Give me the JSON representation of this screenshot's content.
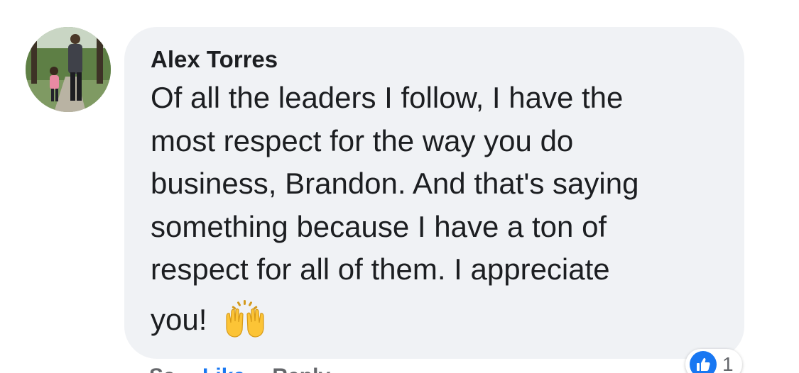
{
  "comment": {
    "author": "Alex Torres",
    "text_lines": [
      "Of all the leaders I follow, I have the",
      "most respect for the way you do",
      "business, Brandon. And that's saying",
      "something because I have a ton of",
      "respect for all of them. I appreciate"
    ],
    "last_line": "you!",
    "emoji": "raising-hands-emoji"
  },
  "actions": {
    "first": "Sa",
    "like": "Like",
    "reply": "Reply"
  },
  "reactions": {
    "icon": "thumbs-up-icon",
    "count": "1",
    "color": "#1877f2"
  },
  "colors": {
    "bubble": "#f0f2f5",
    "text": "#1c1e21",
    "link": "#1877f2",
    "meta": "#65676b"
  }
}
